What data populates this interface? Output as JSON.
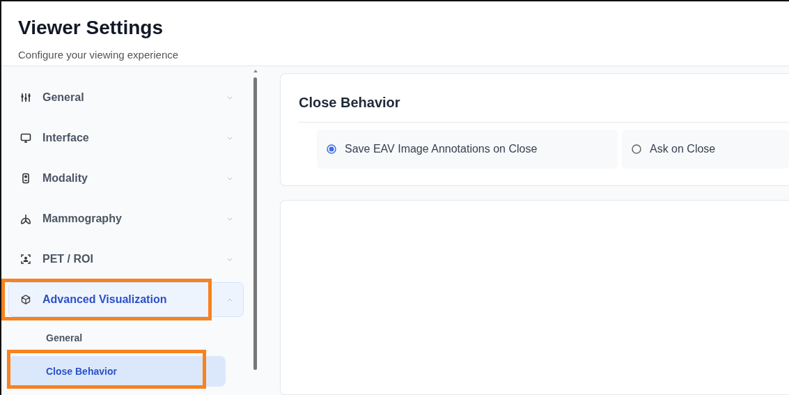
{
  "header": {
    "title": "Viewer Settings",
    "subtitle": "Configure your viewing experience"
  },
  "sidebar": {
    "items": [
      {
        "label": "General",
        "expanded": false,
        "selected": false,
        "highlighted": false
      },
      {
        "label": "Interface",
        "expanded": false,
        "selected": false,
        "highlighted": false
      },
      {
        "label": "Modality",
        "expanded": false,
        "selected": false,
        "highlighted": false
      },
      {
        "label": "Mammography",
        "expanded": false,
        "selected": false,
        "highlighted": false
      },
      {
        "label": "PET / ROI",
        "expanded": false,
        "selected": false,
        "highlighted": false
      },
      {
        "label": "Advanced Visualization",
        "expanded": true,
        "selected": true,
        "highlighted": true,
        "children": [
          {
            "label": "General",
            "selected": false,
            "highlighted": false
          },
          {
            "label": "Close Behavior",
            "selected": true,
            "highlighted": true
          }
        ]
      }
    ]
  },
  "section": {
    "title": "Close Behavior",
    "options": [
      {
        "label": "Save EAV Image Annotations on Close",
        "selected": true
      },
      {
        "label": "Ask on Close",
        "selected": false
      }
    ]
  }
}
